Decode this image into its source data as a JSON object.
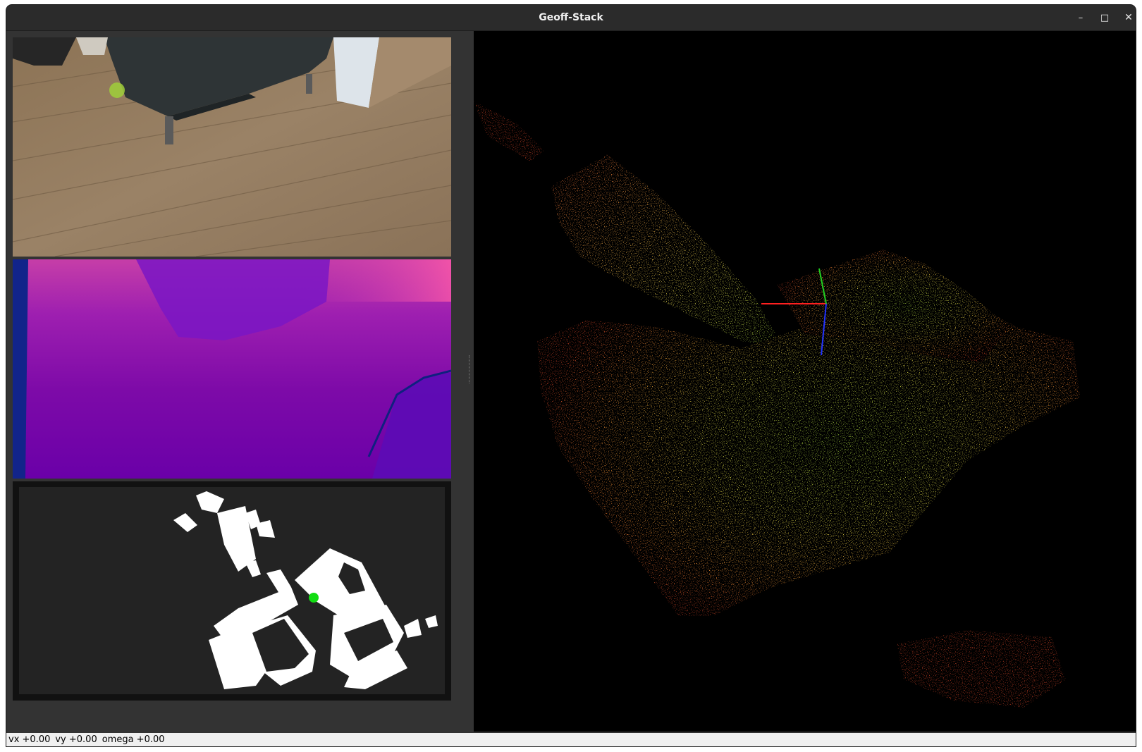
{
  "window": {
    "title": "Geoff-Stack",
    "controls": {
      "minimize": "–",
      "maximize": "□",
      "close": "✕"
    }
  },
  "views": {
    "rgb": {
      "icon": "camera-feed"
    },
    "depth": {
      "icon": "depth-map"
    },
    "occupancy": {
      "icon": "occupancy-grid"
    },
    "cloud": {
      "icon": "point-cloud-3d"
    }
  },
  "status": {
    "vx": "vx +0.00",
    "vy": "vy +0.00",
    "omega": "omega +0.00"
  },
  "colors": {
    "axis_x": "#ff2020",
    "axis_y": "#22d022",
    "axis_z": "#2233ff",
    "robot_marker": "#11dd11",
    "depth_near": "#ff5aa8",
    "depth_far": "#6a00a8"
  }
}
